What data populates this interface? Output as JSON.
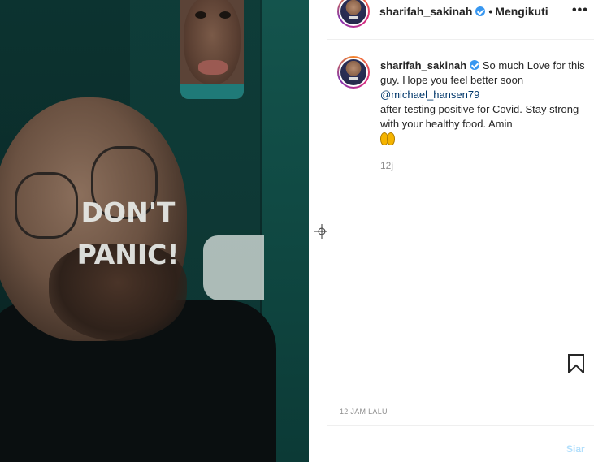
{
  "photo": {
    "headline_line1": "DON'T",
    "headline_line2": "PANIC!"
  },
  "header": {
    "username": "sharifah_sakinah",
    "separator": "•",
    "follow_status": "Mengikuti",
    "more_glyph": "•••"
  },
  "caption": {
    "username": "sharifah_sakinah",
    "text_part1": "So much Love for this guy. Hope you feel better soon",
    "mention": "@michael_hansen79",
    "text_part2": "after testing positive for Covid. Stay strong with your healthy food. Amin",
    "emoji": "folded-hands",
    "time": "12j"
  },
  "footer": {
    "timestamp": "12 JAM LALU",
    "post_label": "Siar"
  },
  "colors": {
    "link": "#00376b",
    "verified": "#3897f0",
    "muted": "#8e8e8e",
    "post_disabled": "#b2dffc"
  }
}
